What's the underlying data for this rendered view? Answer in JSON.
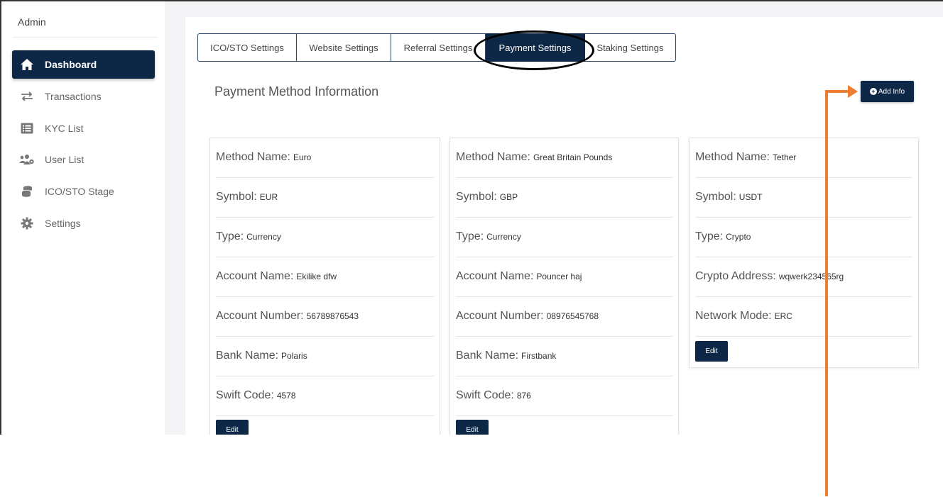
{
  "sidebar": {
    "brand": "Admin",
    "items": [
      {
        "label": "Dashboard",
        "icon": "home-icon",
        "active": true
      },
      {
        "label": "Transactions",
        "icon": "transfer-icon",
        "active": false
      },
      {
        "label": "KYC List",
        "icon": "list-icon",
        "active": false
      },
      {
        "label": "User List",
        "icon": "users-icon",
        "active": false
      },
      {
        "label": "ICO/STO Stage",
        "icon": "coins-icon",
        "active": false
      },
      {
        "label": "Settings",
        "icon": "gear-icon",
        "active": false
      }
    ]
  },
  "tabs": [
    {
      "label": "ICO/STO Settings",
      "active": false
    },
    {
      "label": "Website Settings",
      "active": false
    },
    {
      "label": "Referral Settings",
      "active": false
    },
    {
      "label": "Payment Settings",
      "active": true
    },
    {
      "label": "Staking Settings",
      "active": false
    }
  ],
  "section_title": "Payment Method Information",
  "add_button_label": "Add Info",
  "cards": [
    {
      "rows": [
        {
          "label": "Method Name:",
          "value": "Euro"
        },
        {
          "label": "Symbol:",
          "value": "EUR"
        },
        {
          "label": "Type:",
          "value": "Currency"
        },
        {
          "label": "Account Name:",
          "value": "Ekilike dfw"
        },
        {
          "label": "Account Number:",
          "value": "56789876543"
        },
        {
          "label": "Bank Name:",
          "value": "Polaris"
        },
        {
          "label": "Swift Code:",
          "value": "4578"
        }
      ],
      "edit_label": "Edit"
    },
    {
      "rows": [
        {
          "label": "Method Name:",
          "value": "Great Britain Pounds"
        },
        {
          "label": "Symbol:",
          "value": "GBP"
        },
        {
          "label": "Type:",
          "value": "Currency"
        },
        {
          "label": "Account Name:",
          "value": "Pouncer haj"
        },
        {
          "label": "Account Number:",
          "value": "08976545768"
        },
        {
          "label": "Bank Name:",
          "value": "Firstbank"
        },
        {
          "label": "Swift Code:",
          "value": "876"
        }
      ],
      "edit_label": "Edit"
    },
    {
      "rows": [
        {
          "label": "Method Name:",
          "value": "Tether"
        },
        {
          "label": "Symbol:",
          "value": "USDT"
        },
        {
          "label": "Type:",
          "value": "Crypto"
        },
        {
          "label": "Crypto Address:",
          "value": "wqwerk234565rg"
        },
        {
          "label": "Network Mode:",
          "value": "ERC"
        }
      ],
      "edit_label": "Edit"
    }
  ],
  "colors": {
    "primary": "#0d2847",
    "annotation_arrow": "#ed7d31",
    "annotation_circle": "#000000"
  }
}
